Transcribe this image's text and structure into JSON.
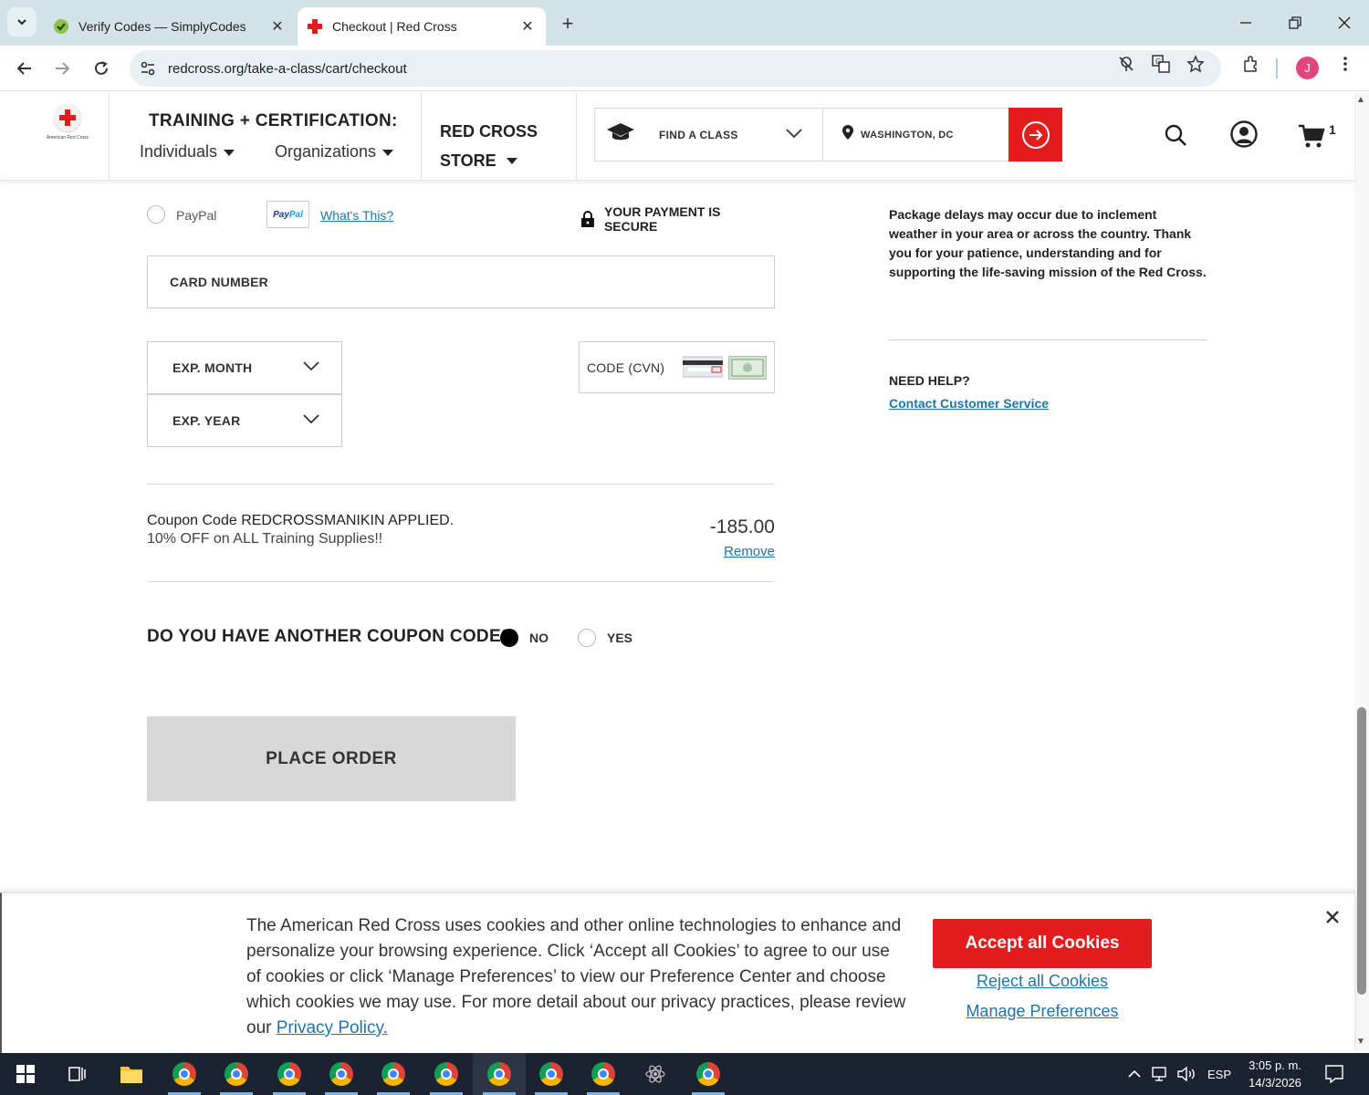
{
  "browser": {
    "tabs": [
      {
        "title": "Verify Codes — SimplyCodes",
        "active": false
      },
      {
        "title": "Checkout | Red Cross",
        "active": true
      }
    ],
    "url": "redcross.org/take-a-class/cart/checkout",
    "profile_initial": "J"
  },
  "header": {
    "logo_text": "American Red Cross",
    "training_title": "TRAINING + CERTIFICATION:",
    "individuals": "Individuals",
    "organizations": "Organizations",
    "store_line1": "RED CROSS",
    "store_line2": "STORE",
    "find_class": "FIND A CLASS",
    "location": "WASHINGTON, DC",
    "cart_count": "1"
  },
  "payment": {
    "paypal_label": "PayPal",
    "paypal_badge_1": "Pay",
    "paypal_badge_2": "Pal",
    "whats_this": "What's This?",
    "secure_label": "YOUR PAYMENT IS SECURE",
    "card_number": "CARD NUMBER",
    "exp_month": "EXP. MONTH",
    "exp_year": "EXP. YEAR",
    "cvn": "CODE (CVN)"
  },
  "coupon": {
    "title": "Coupon Code REDCROSSMANIKIN APPLIED.",
    "subtitle": "10% OFF on ALL Training Supplies!!",
    "amount": "-185.00",
    "remove": "Remove",
    "another_question": "DO YOU HAVE ANOTHER COUPON CODE?",
    "no": "NO",
    "yes": "YES",
    "selected": "NO"
  },
  "actions": {
    "place_order": "PLACE ORDER"
  },
  "sidebar": {
    "notice": "Package delays may occur due to inclement weather in your area or across the country. Thank you for your patience, understanding and for supporting the life-saving mission of the Red Cross.",
    "need_help": "NEED HELP?",
    "contact": "Contact Customer Service"
  },
  "cookie_banner": {
    "text": "The American Red Cross uses cookies and other online technologies to enhance and personalize your browsing experience. Click ‘Accept all Cookies’ to agree to our use of cookies or click ‘Manage Preferences’ to view our Preference Center and choose which cookies we may use. For more detail about our privacy practices, please review our ",
    "privacy_link": "Privacy Policy.",
    "accept": "Accept all Cookies",
    "reject": "Reject all Cookies",
    "manage": "Manage Preferences"
  },
  "taskbar": {
    "language": "ESP",
    "time": "3:05 p. m.",
    "date": "14/3/2026"
  },
  "colors": {
    "brand_red": "#e31d1d",
    "link_blue": "#1f75a8",
    "tab_strip": "#d3e3e8"
  }
}
